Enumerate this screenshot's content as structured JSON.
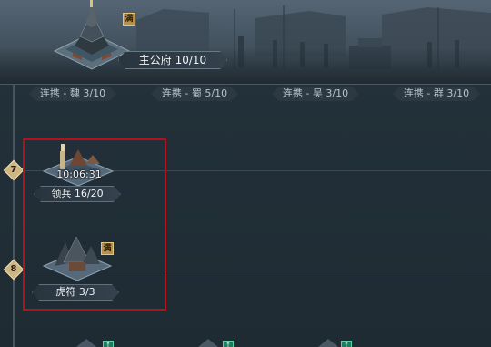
{
  "main_building": {
    "label": "主公府 10/10",
    "badge": "满"
  },
  "alliance_tabs": [
    {
      "label": "连携 - 魏 3/10"
    },
    {
      "label": "连携 - 蜀 5/10"
    },
    {
      "label": "连携 - 吴 3/10"
    },
    {
      "label": "连携 - 群 3/10"
    }
  ],
  "levels": [
    {
      "number": "7"
    },
    {
      "number": "8"
    }
  ],
  "nodes": [
    {
      "label": "领兵 16/20",
      "timer": "10:06:31"
    },
    {
      "label": "虎符 3/3",
      "badge": "满"
    }
  ],
  "bottom_badges": [
    "↑",
    "↑",
    "↑"
  ],
  "colors": {
    "selection": "#b3121c",
    "level_marker": "#cdb683",
    "full_badge": "#b6904f",
    "upgrade_badge": "#1d7b60"
  }
}
